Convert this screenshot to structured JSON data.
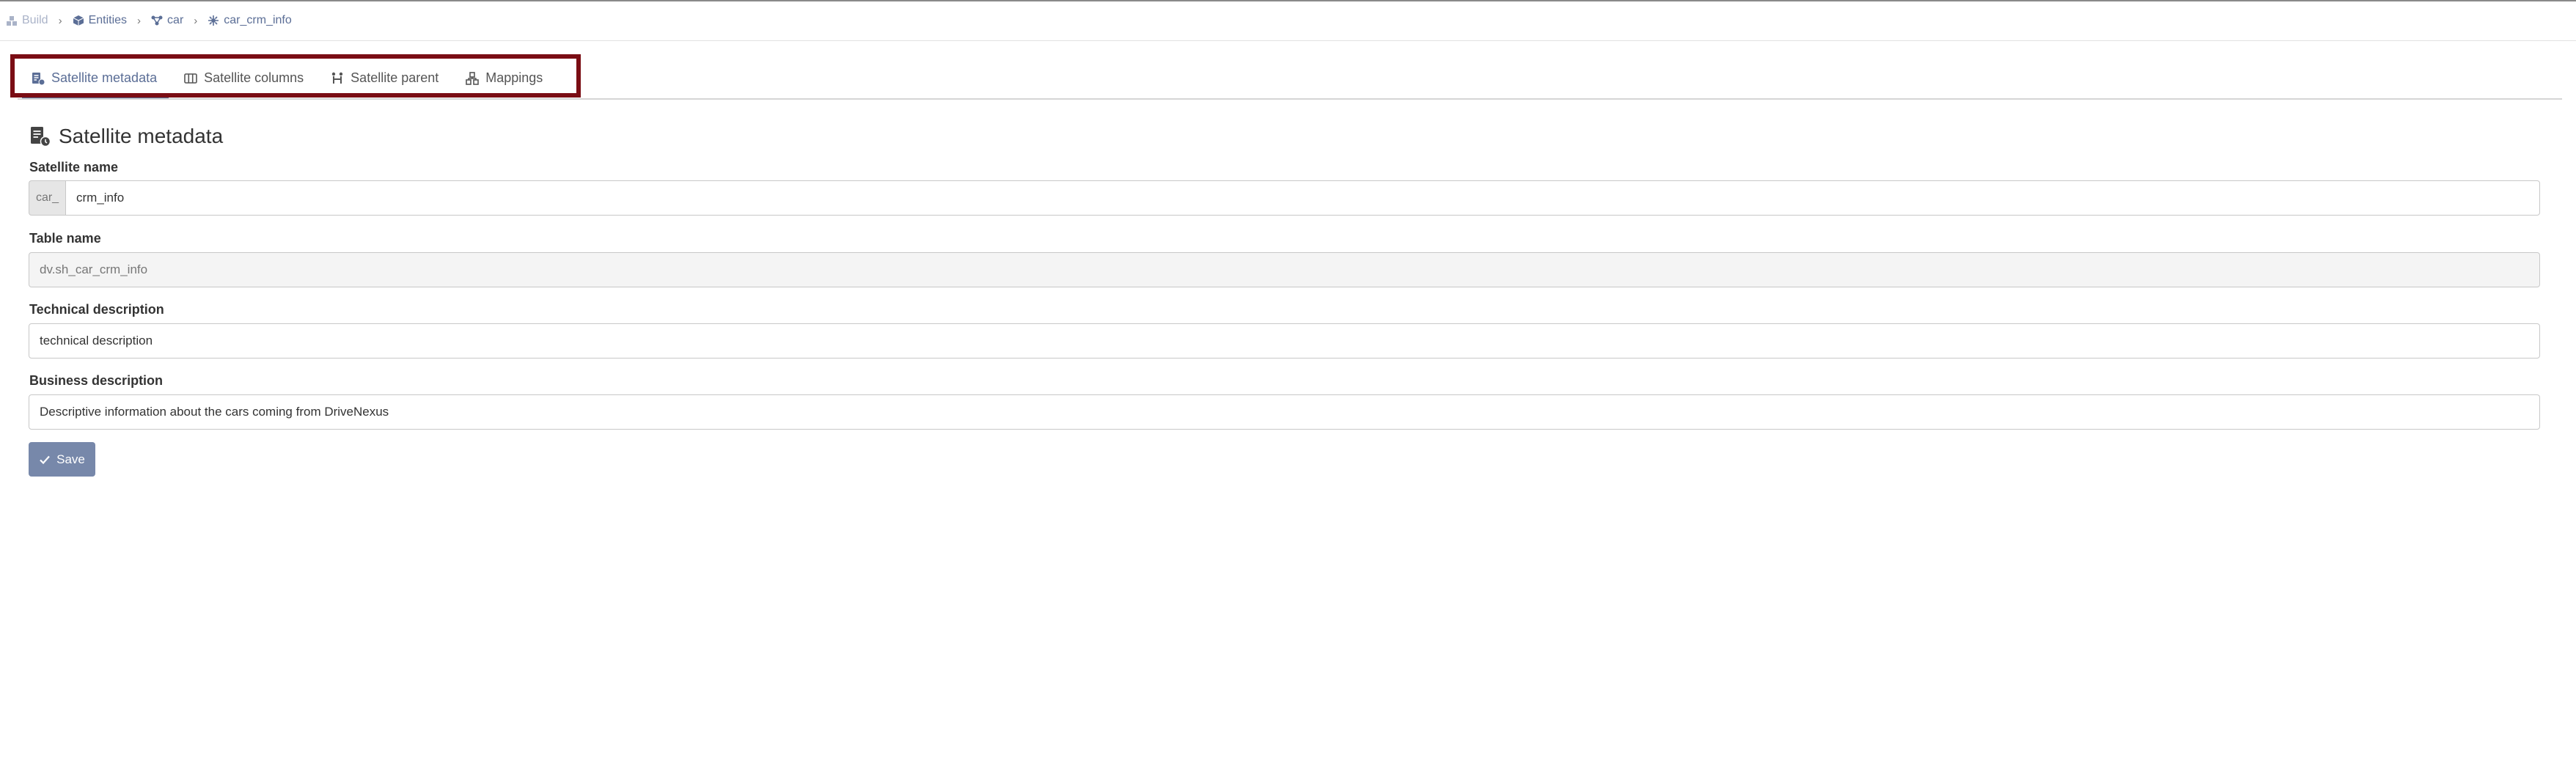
{
  "breadcrumb": {
    "items": [
      {
        "label": "Build",
        "icon": "build-icon"
      },
      {
        "label": "Entities",
        "icon": "cube-icon"
      },
      {
        "label": "car",
        "icon": "hub-icon"
      },
      {
        "label": "car_crm_info",
        "icon": "satellite-icon"
      }
    ],
    "separator": "›"
  },
  "tabs": [
    {
      "label": "Satellite metadata",
      "icon": "metadata-icon",
      "active": true
    },
    {
      "label": "Satellite columns",
      "icon": "columns-icon",
      "active": false
    },
    {
      "label": "Satellite parent",
      "icon": "parent-icon",
      "active": false
    },
    {
      "label": "Mappings",
      "icon": "mappings-icon",
      "active": false
    }
  ],
  "form": {
    "title": "Satellite metadata",
    "satellite_name": {
      "label": "Satellite name",
      "prefix": "car_",
      "value": "crm_info"
    },
    "table_name": {
      "label": "Table name",
      "value": "dv.sh_car_crm_info"
    },
    "technical_description": {
      "label": "Technical description",
      "value": "technical description"
    },
    "business_description": {
      "label": "Business description",
      "value": "Descriptive information about the cars coming from DriveNexus"
    },
    "save_label": "Save"
  },
  "colors": {
    "accent": "#5b6e96",
    "button": "#7788aa",
    "highlight_border": "#7a0d14"
  }
}
